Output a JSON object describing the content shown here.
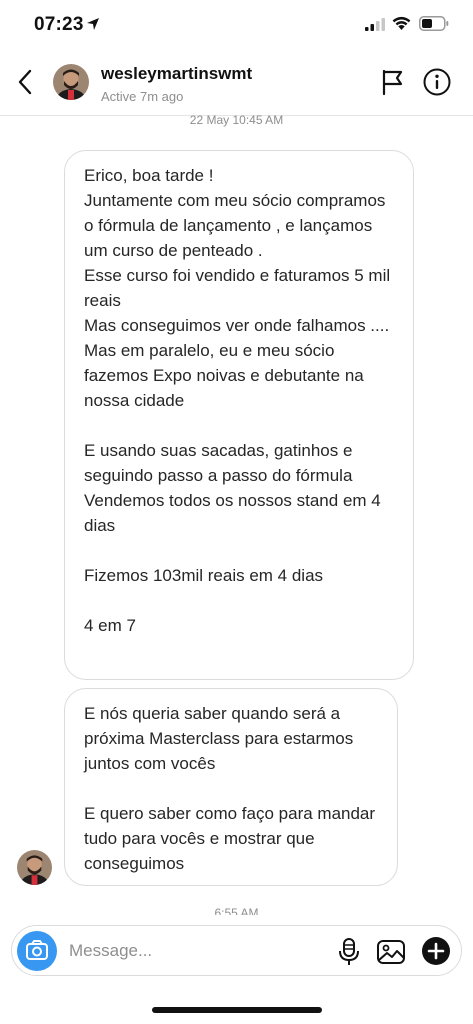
{
  "status_bar": {
    "time": "07:23",
    "icons": [
      "location-arrow-icon",
      "signal-icon",
      "wifi-icon",
      "battery-icon"
    ]
  },
  "header": {
    "username": "wesleymartinswmt",
    "active_status": "Active 7m ago",
    "icons": [
      "back-icon",
      "flag-icon",
      "info-icon"
    ]
  },
  "chat": {
    "timestamp_top": "22 May 10:45 AM",
    "timestamp_bottom": "6:55 AM",
    "messages": [
      {
        "text": "Erico, boa tarde !\nJuntamente com meu sócio compramos o fórmula de lançamento , e lançamos um curso de penteado .\nEsse curso foi vendido e faturamos 5 mil reais\nMas conseguimos ver onde falhamos ....\nMas em paralelo, eu e meu sócio fazemos Expo noivas e debutante na nossa cidade\n\nE usando suas sacadas, gatinhos e seguindo passo a passo do fórmula\nVendemos todos os nossos stand em 4 dias\n\nFizemos 103mil reais em 4 dias\n\n4 em 7"
      },
      {
        "text": "E nós queria saber quando será a próxima Masterclass para estarmos juntos com vocês\n\nE quero saber como faço para mandar tudo para vocês e mostrar que conseguimos"
      }
    ]
  },
  "composer": {
    "placeholder": "Message...",
    "icons": [
      "camera-icon",
      "microphone-icon",
      "gallery-icon",
      "plus-icon"
    ]
  },
  "colors": {
    "accent": "#3897f0",
    "bubble_border": "#dbdbdb",
    "secondary_text": "#8e8e8e"
  }
}
